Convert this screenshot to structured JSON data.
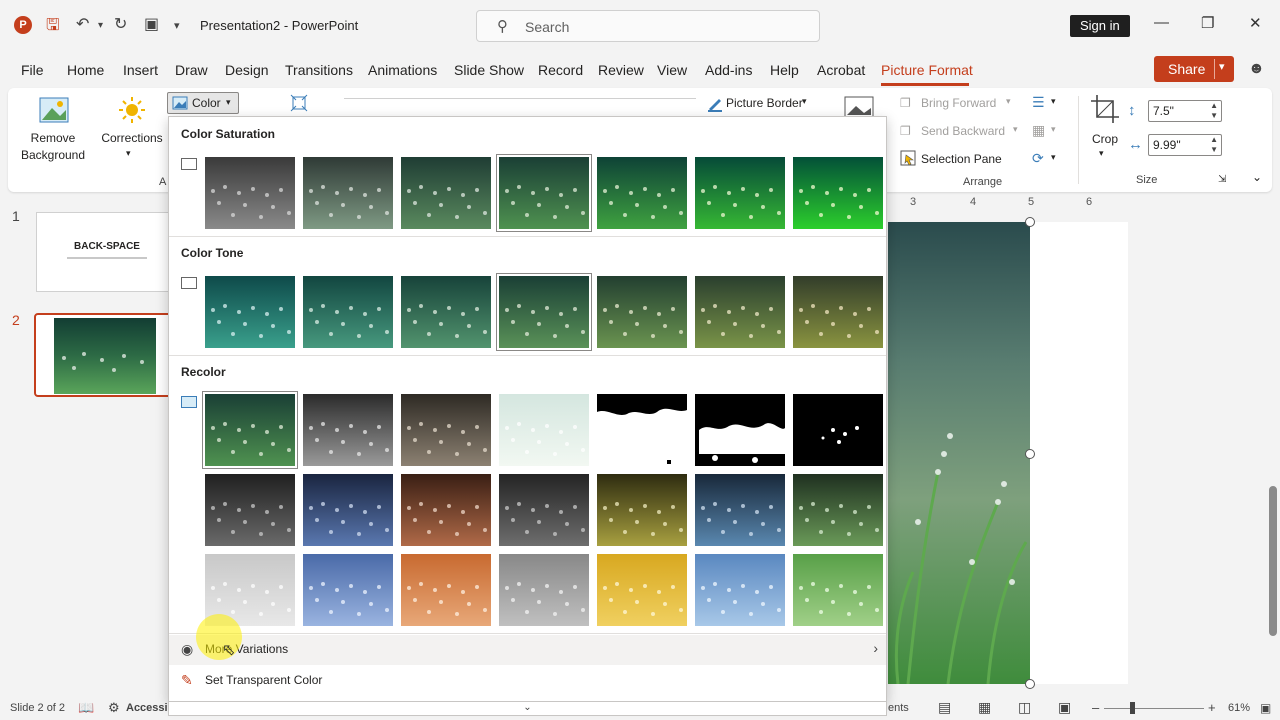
{
  "app": {
    "logo_letter": "P",
    "title": "Presentation2  -  PowerPoint",
    "search_placeholder": "Search",
    "signin_label": "Sign in"
  },
  "menu_tabs": [
    "File",
    "Home",
    "Insert",
    "Draw",
    "Design",
    "Transitions",
    "Animations",
    "Slide Show",
    "Record",
    "Review",
    "View",
    "Add-ins",
    "Help",
    "Acrobat",
    "Picture Format"
  ],
  "share_label": "Share",
  "ribbon": {
    "remove_bg": "Remove\nBackground",
    "corrections": "Corrections",
    "color_label": "Color",
    "group_adjust_partial": "A",
    "picture_border": "Picture Border",
    "bring_forward": "Bring Forward",
    "send_backward": "Send Backward",
    "selection_pane": "Selection Pane",
    "arrange_group": "Arrange",
    "crop": "Crop",
    "height_value": "7.5\"",
    "width_value": "9.99\"",
    "size_group": "Size"
  },
  "slides": [
    {
      "number": "1",
      "title": "BACK-SPACE"
    },
    {
      "number": "2"
    }
  ],
  "ruler_marks": [
    "3",
    "4",
    "5",
    "6"
  ],
  "dropdown": {
    "saturation_title": "Color Saturation",
    "tone_title": "Color Tone",
    "recolor_title": "Recolor",
    "more_variations": "More Variations",
    "set_transparent": "Set Transparent Color"
  },
  "statusbar": {
    "slide_info": "Slide 2 of 2",
    "accessibility": "Accessib",
    "comments_partial": "ents",
    "zoom": "61%"
  },
  "colors": {
    "accent": "#c43e1c",
    "grass": "#3a8a3a"
  },
  "icons": [
    "save-icon",
    "undo-icon",
    "redo-icon",
    "present-icon",
    "search-icon",
    "minimize-icon",
    "restore-icon",
    "close-icon",
    "person-icon",
    "chevron-right-icon"
  ]
}
